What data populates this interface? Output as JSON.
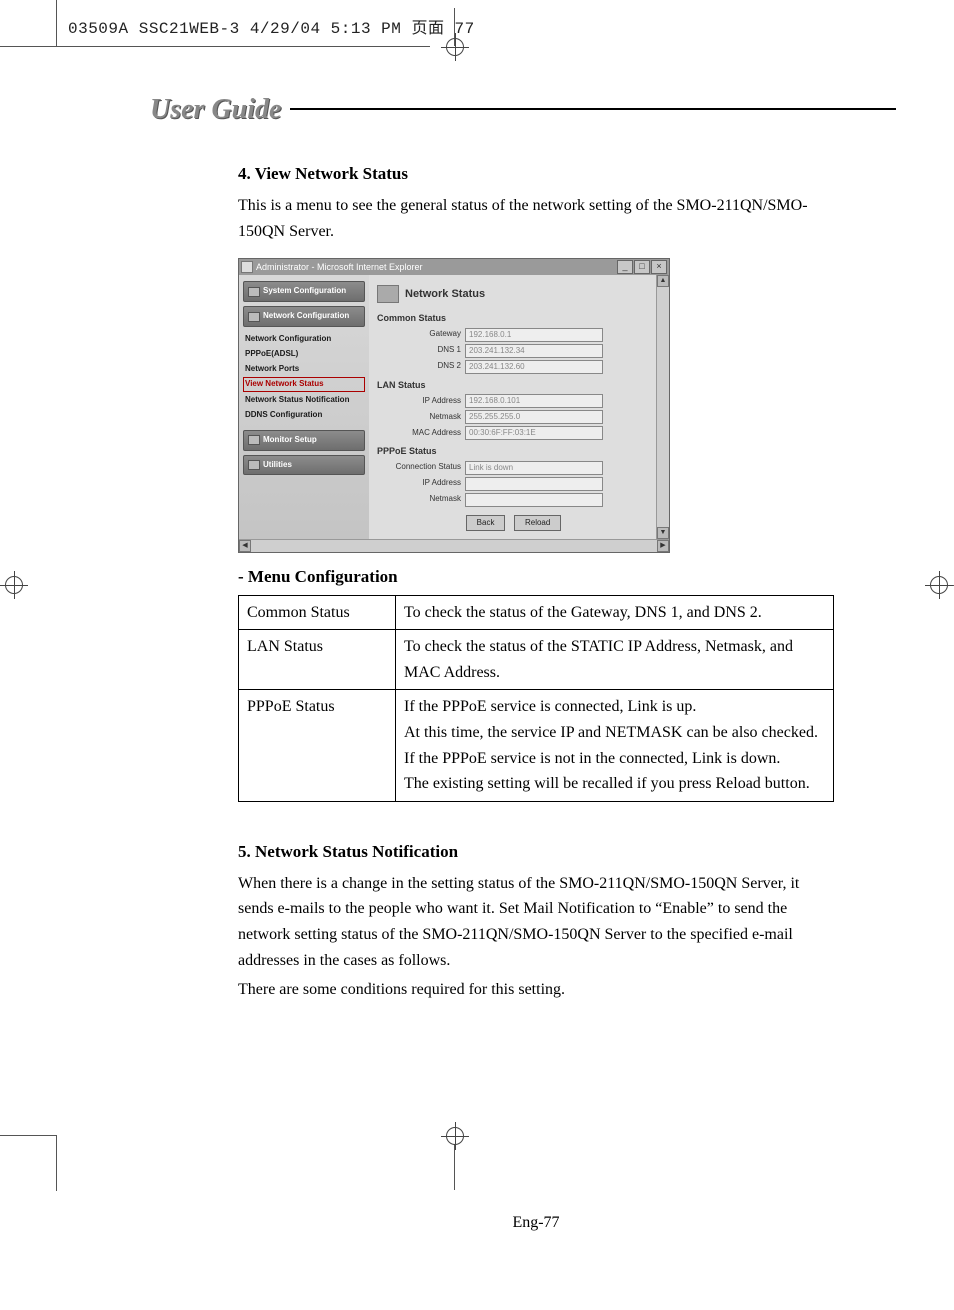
{
  "crop_header": "03509A SSC21WEB-3  4/29/04  5:13 PM  页面 77",
  "page_title": "User Guide",
  "section4_heading": "4. View Network Status",
  "section4_para": "This is a menu to see the general status of the network setting of the SMO-211QN/SMO-150QN Server.",
  "ie": {
    "title": "Administrator - Microsoft Internet Explorer",
    "sidebar": {
      "system_config": "System Configuration",
      "network_config_btn": "Network Configuration",
      "links": {
        "nc": "Network Configuration",
        "pppoe": "PPPoE(ADSL)",
        "ports": "Network Ports",
        "view_status": "View Network Status",
        "notify": "Network Status Notification",
        "ddns": "DDNS Configuration"
      },
      "monitor_setup": "Monitor Setup",
      "utilities": "Utilities"
    },
    "panel_title": "Network Status",
    "sections": {
      "common": "Common Status",
      "lan": "LAN Status",
      "pppoe": "PPPoE Status"
    },
    "fields": {
      "gateway_l": "Gateway",
      "gateway_v": "192.168.0.1",
      "dns1_l": "DNS 1",
      "dns1_v": "203.241.132.34",
      "dns2_l": "DNS 2",
      "dns2_v": "203.241.132.60",
      "ip_l": "IP Address",
      "ip_v": "192.168.0.101",
      "mask_l": "Netmask",
      "mask_v": "255.255.255.0",
      "mac_l": "MAC Address",
      "mac_v": "00:30:6F:FF:03:1E",
      "conn_l": "Connection Status",
      "conn_v": "Link is down",
      "pip_l": "IP Address",
      "pip_v": "",
      "pmask_l": "Netmask",
      "pmask_v": ""
    },
    "buttons": {
      "back": "Back",
      "reload": "Reload"
    }
  },
  "menu_config_title": "- Menu Configuration",
  "table": {
    "r1l": "Common Status",
    "r1r": "To check the status of the Gateway, DNS 1, and DNS 2.",
    "r2l": "LAN Status",
    "r2r": "To check the status of the STATIC IP Address, Netmask, and MAC Address.",
    "r3l": "PPPoE Status",
    "r3r": "If the PPPoE service is connected, Link is up.\nAt this time, the service IP and NETMASK can be also checked.\nIf the PPPoE service is not in the connected, Link is down.\nThe existing setting will be recalled if you press Reload button."
  },
  "section5_heading": "5. Network Status Notification",
  "section5_para1": "When there is a change in the setting status of the SMO-211QN/SMO-150QN Server, it sends e-mails to the people who want it. Set Mail Notification to “Enable” to send the network setting status of the SMO-211QN/SMO-150QN Server to the specified e-mail addresses in the cases as follows.",
  "section5_para2": "There are some conditions required for this setting.",
  "page_number": "Eng-77"
}
